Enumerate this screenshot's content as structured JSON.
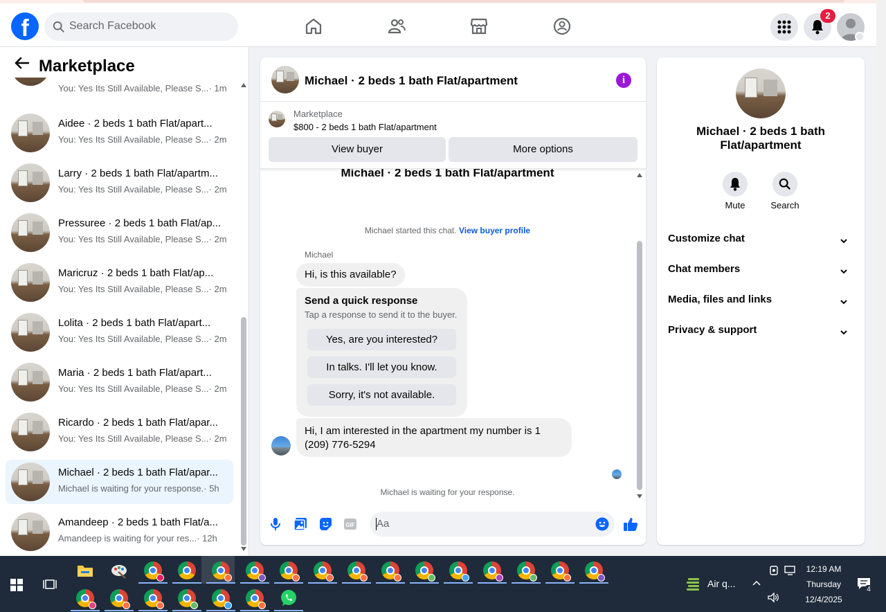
{
  "search": {
    "placeholder": "Search Facebook"
  },
  "header": {
    "notifications_count": "2"
  },
  "sidebar": {
    "title": "Marketplace",
    "partial_item": {
      "snippet": "You: Yes Its Still Available, Please S...",
      "time": "· 1m"
    },
    "conversations": [
      {
        "name": "Aidee · 2 beds 1 bath Flat/apart...",
        "snippet": "You: Yes Its Still Available, Please S...",
        "time": "· 2m",
        "active": false
      },
      {
        "name": "Larry · 2 beds 1 bath Flat/apartm...",
        "snippet": "You: Yes Its Still Available, Please S...",
        "time": "· 2m",
        "active": false
      },
      {
        "name": "Pressuree · 2 beds 1 bath Flat/ap...",
        "snippet": "You: Yes Its Still Available, Please S...",
        "time": "· 2m",
        "active": false
      },
      {
        "name": "Maricruz · 2 beds 1 bath Flat/ap...",
        "snippet": "You: Yes Its Still Available, Please S...",
        "time": "· 2m",
        "active": false
      },
      {
        "name": "Lolita · 2 beds 1 bath Flat/apart...",
        "snippet": "You: Yes Its Still Available, Please S...",
        "time": "· 2m",
        "active": false
      },
      {
        "name": "Maria · 2 beds 1 bath Flat/apart...",
        "snippet": "You: Yes Its Still Available, Please S...",
        "time": "· 2m",
        "active": false
      },
      {
        "name": "Ricardo · 2 beds 1 bath Flat/apar...",
        "snippet": "You: Yes Its Still Available, Please S...",
        "time": "· 2m",
        "active": false
      },
      {
        "name": "Michael · 2 beds 1 bath Flat/apar...",
        "snippet": "Michael is waiting for your response.",
        "time": "· 5h",
        "active": true
      },
      {
        "name": "Amandeep · 2 beds 1 bath Flat/a...",
        "snippet": "Amandeep is waiting for your res...",
        "time": "· 12h",
        "active": false
      }
    ]
  },
  "chat": {
    "title": "Michael · 2 beds 1 bath Flat/apartment",
    "marketplace_label": "Marketplace",
    "listing": "$800 - 2 beds 1 bath Flat/apartment",
    "view_buyer": "View buyer",
    "more_options": "More options",
    "body_title": "Michael · 2 beds 1 bath Flat/apartment",
    "started_text": "Michael started this chat.",
    "view_profile": "View buyer profile",
    "sender": "Michael",
    "msg1": "Hi, is this available?",
    "quick_title": "Send a quick response",
    "quick_sub": "Tap a response to send it to the buyer.",
    "quick_options": [
      "Yes, are you interested?",
      "In talks. I'll let you know.",
      "Sorry, it's not available."
    ],
    "msg2_line1": "Hi, I am interested in the apartment my number is 1",
    "msg2_line2": "(209) 776-5294",
    "waiting": "Michael is waiting for your response.",
    "composer_placeholder": "Aa"
  },
  "right_panel": {
    "title": "Michael · 2 beds 1 bath Flat/apartment",
    "mute": "Mute",
    "search": "Search",
    "sections": [
      "Customize chat",
      "Chat members",
      "Media, files and links",
      "Privacy & support"
    ]
  },
  "taskbar": {
    "weather": "Air q...",
    "time": "12:19 AM",
    "day": "Thursday",
    "date": "12/4/2025",
    "notif_count": "4"
  }
}
